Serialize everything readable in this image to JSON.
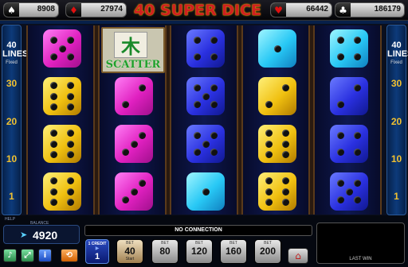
{
  "title": "40 SUPER DICE",
  "jackpots": [
    {
      "suit": "spades",
      "glyph": "♠",
      "value": "8908",
      "color": "#ffffff"
    },
    {
      "suit": "diamonds",
      "glyph": "♦",
      "value": "27974",
      "color": "#e01010"
    },
    {
      "suit": "hearts",
      "glyph": "♥",
      "value": "66442",
      "color": "#e01010"
    },
    {
      "suit": "clubs",
      "glyph": "♣",
      "value": "186179",
      "color": "#ffffff"
    }
  ],
  "side_panel": {
    "lines_count": "40",
    "lines_label": "LINES",
    "lines_sub": "Fixed",
    "numbers": [
      "30",
      "20",
      "10",
      "1"
    ]
  },
  "reels": [
    [
      {
        "color": "pink",
        "pips": 5
      },
      {
        "color": "yellow",
        "pips": 6
      },
      {
        "color": "yellow",
        "pips": 6
      },
      {
        "color": "yellow",
        "pips": 6
      }
    ],
    [
      {
        "symbol": "scatter"
      },
      {
        "color": "pink",
        "pips": 2
      },
      {
        "color": "pink",
        "pips": 3
      },
      {
        "color": "pink",
        "pips": 3
      }
    ],
    [
      {
        "color": "blue",
        "pips": 4
      },
      {
        "color": "blue",
        "pips": 5
      },
      {
        "color": "blue",
        "pips": 5
      },
      {
        "color": "cyan",
        "pips": 1
      }
    ],
    [
      {
        "color": "cyan",
        "pips": 1
      },
      {
        "color": "yellow",
        "pips": 2
      },
      {
        "color": "yellow",
        "pips": 6
      },
      {
        "color": "yellow",
        "pips": 6
      }
    ],
    [
      {
        "color": "cyan",
        "pips": 4
      },
      {
        "color": "blue",
        "pips": 2
      },
      {
        "color": "blue",
        "pips": 4
      },
      {
        "color": "blue",
        "pips": 5
      }
    ]
  ],
  "scatter": {
    "label": "SCATTER",
    "glyph": "木"
  },
  "bottom": {
    "help_label": "HELP",
    "balance_label": "BALANCE",
    "balance_value": "4920",
    "status_text": "NO CONNECTION",
    "credit_label": "1 CREDIT",
    "credit_value": "1",
    "bet_label": "BET",
    "bets": [
      "40",
      "80",
      "120",
      "160",
      "200"
    ],
    "bet_start_label": "Start",
    "last_win_label": "LAST WIN"
  },
  "icons": {
    "sound": "sound-icon",
    "fullscreen": "fullscreen-icon",
    "info": "info-icon",
    "autoplay": "autoplay-icon",
    "home": "home-icon"
  }
}
